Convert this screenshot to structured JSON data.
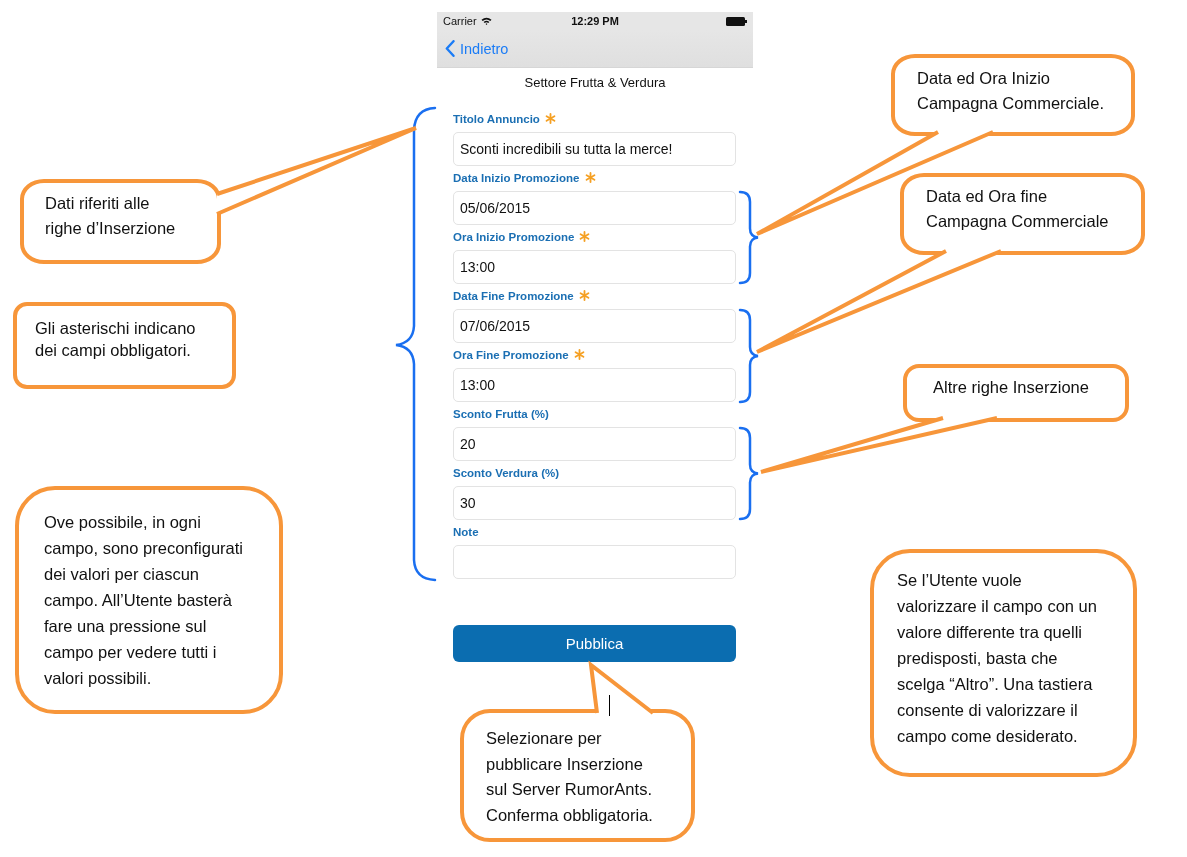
{
  "status_bar": {
    "carrier": "Carrier",
    "time": "12:29 PM"
  },
  "nav_bar": {
    "back_label": "Indietro"
  },
  "screen_title": "Settore Frutta & Verdura",
  "form": {
    "fields": [
      {
        "label": "Titolo Annuncio",
        "value": "Sconti incredibili su tutta la merce!",
        "required": true
      },
      {
        "label": "Data Inizio Promozione",
        "value": "05/06/2015",
        "required": true
      },
      {
        "label": "Ora Inizio Promozione",
        "value": "13:00",
        "required": true
      },
      {
        "label": "Data Fine Promozione",
        "value": "07/06/2015",
        "required": true
      },
      {
        "label": "Ora Fine Promozione",
        "value": "13:00",
        "required": true
      },
      {
        "label": "Sconto Frutta (%)",
        "value": "20",
        "required": false
      },
      {
        "label": "Sconto Verdura (%)",
        "value": "30",
        "required": false
      },
      {
        "label": "Note",
        "required": false
      }
    ],
    "submit_button": "Pubblica"
  },
  "callouts": [
    {
      "text": "Dati riferiti alle\nrighe d’Inserzione"
    },
    {
      "text": "Gli asterischi indicano\ndei campi obbligatori."
    },
    {
      "text": "Ove possibile, in ogni\ncampo, sono preconfigurati\ndei valori per ciascun\ncampo. All’Utente basterà\nfare una pressione sul\ncampo per vedere tutti i\nvalori possibili."
    },
    {
      "text": "Selezionare per\npubblicare Inserzione\nsul Server RumorAnts.\nConferma obbligatoria."
    },
    {
      "text": "Data ed Ora Inizio\nCampagna Commerciale."
    },
    {
      "text": "Data ed Ora fine\nCampagna Commerciale"
    },
    {
      "text": "Altre righe Inserzione"
    },
    {
      "text": "Se l’Utente vuole\nvalorizzare il campo con un\nvalore differente tra quelli\npredisposti, basta che\nscelga “Altro”. Una tastiera\nconsente di valorizzare il\ncampo come desiderato."
    }
  ]
}
